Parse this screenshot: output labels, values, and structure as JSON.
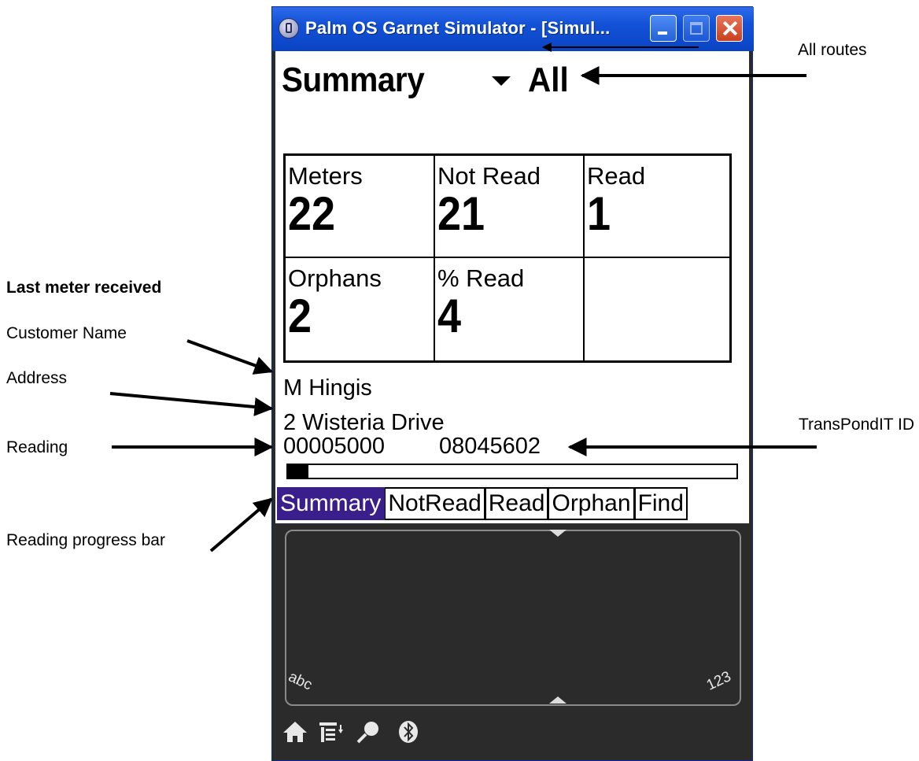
{
  "window": {
    "title": "Palm OS Garnet Simulator - [Simul..."
  },
  "screen": {
    "title": "Summary",
    "route_selector": {
      "value": "All"
    },
    "stats": [
      {
        "label": "Meters",
        "value": "22"
      },
      {
        "label": "Not Read",
        "value": "21"
      },
      {
        "label": "Read",
        "value": "1"
      },
      {
        "label": "Orphans",
        "value": "2"
      },
      {
        "label": "% Read",
        "value": "4"
      },
      {
        "label": "",
        "value": ""
      }
    ],
    "last_meter": {
      "customer_name": "M Hingis",
      "address": "2 Wisteria Drive",
      "reading": "00005000",
      "transponder_id": "08045602"
    },
    "progress_fraction": 0.045,
    "tabs": [
      {
        "label": "Summary",
        "active": true
      },
      {
        "label": "NotRead",
        "active": false
      },
      {
        "label": "Read",
        "active": false
      },
      {
        "label": "Orphan",
        "active": false
      },
      {
        "label": "Find",
        "active": false
      }
    ]
  },
  "graffiti": {
    "left_label": "abc",
    "right_label": "123"
  },
  "silk_icons": [
    "home-icon",
    "menu-icon",
    "search-icon",
    "bluetooth-icon"
  ],
  "annotations": {
    "all_routes": "All routes",
    "last_meter_received": "Last meter received",
    "customer_name": "Customer Name",
    "address": "Address",
    "reading": "Reading",
    "transpondit_id": "TransPondIT ID",
    "reading_progress_bar": "Reading progress bar"
  },
  "colors": {
    "titlebar": "#1251d6",
    "active_tab": "#3a1e8c",
    "close_button": "#d9502e",
    "device_body": "#2b2b2b"
  }
}
